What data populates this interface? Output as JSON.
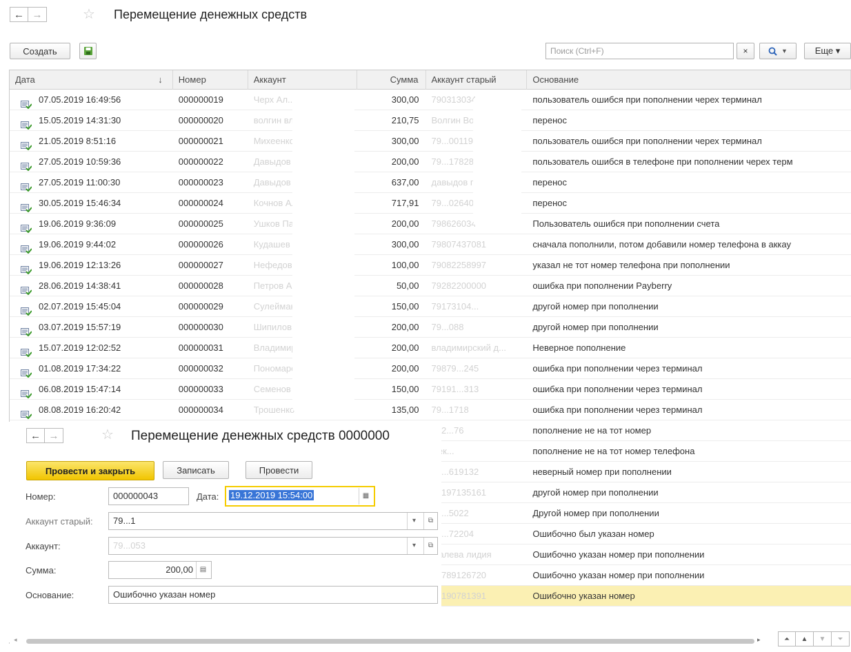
{
  "window": {
    "title": "Перемещение денежных средств",
    "back_arrow": "←",
    "forward_arrow": "→",
    "favorite_star": "☆"
  },
  "toolbar": {
    "create_label": "Создать",
    "search_placeholder": "Поиск (Ctrl+F)",
    "search_clear": "×",
    "search_button": "🔍 ▾",
    "more_label": "Еще ▾"
  },
  "table": {
    "columns": {
      "date": "Дата",
      "number": "Номер",
      "account": "Аккаунт",
      "sum": "Сумма",
      "old_account": "Аккаунт старый",
      "reason": "Основание"
    },
    "sort_indicator": "↓",
    "rows": [
      {
        "date": "07.05.2019 16:49:56",
        "number": "000000019",
        "account": "Черх Ал...",
        "sum": "300,00",
        "old_account": "79031303447",
        "reason": "пользователь ошибся при пополнении черех терминал"
      },
      {
        "date": "15.05.2019 14:31:30",
        "number": "000000020",
        "account": "волгин владим...",
        "sum": "210,75",
        "old_account": "Волгин Волода",
        "reason": "перенос"
      },
      {
        "date": "21.05.2019 8:51:16",
        "number": "000000021",
        "account": "Михеенко В...",
        "sum": "300,00",
        "old_account": "79...001199",
        "reason": "пользователь ошибся при пополнении черех терминал"
      },
      {
        "date": "27.05.2019 10:59:36",
        "number": "000000022",
        "account": "Давыдов ...",
        "sum": "200,00",
        "old_account": "79...178289",
        "reason": "пользователь ошибся в телефоне при пополнении черех терм"
      },
      {
        "date": "27.05.2019 11:00:30",
        "number": "000000023",
        "account": "Давыдов Гр...",
        "sum": "637,00",
        "old_account": "давыдов григорий",
        "reason": "перенос"
      },
      {
        "date": "30.05.2019 15:46:34",
        "number": "000000024",
        "account": "Кочнов Алекса...",
        "sum": "717,91",
        "old_account": "79...02640",
        "reason": "перенос"
      },
      {
        "date": "19.06.2019 9:36:09",
        "number": "000000025",
        "account": "Ушков Павел",
        "sum": "200,00",
        "old_account": "79862603478",
        "reason": "Пользователь ошибся при пополнении счета"
      },
      {
        "date": "19.06.2019 9:44:02",
        "number": "000000026",
        "account": "Кудашев Андр...",
        "sum": "300,00",
        "old_account": "79807437081",
        "reason": "сначала пополнили, потом добавили номер телефона в аккау"
      },
      {
        "date": "19.06.2019 12:13:26",
        "number": "000000027",
        "account": "Нефедов Оле...",
        "sum": "100,00",
        "old_account": "79082258997",
        "reason": "указал не тот номер телефона при пополнении"
      },
      {
        "date": "28.06.2019 14:38:41",
        "number": "000000028",
        "account": "Петров Ан...",
        "sum": "50,00",
        "old_account": "79282200000",
        "reason": "ошибка при пополнении Payberry"
      },
      {
        "date": "02.07.2019 15:45:04",
        "number": "000000029",
        "account": "Сулейманов Р...",
        "sum": "150,00",
        "old_account": "79173104...",
        "reason": "другой номер при пополнении"
      },
      {
        "date": "03.07.2019 15:57:19",
        "number": "000000030",
        "account": "Шипилов Серг...",
        "sum": "200,00",
        "old_account": "79...088",
        "reason": "другой номер при пополнении"
      },
      {
        "date": "15.07.2019 12:02:52",
        "number": "000000031",
        "account": "Владимирский ...",
        "sum": "200,00",
        "old_account": "владимирский д...",
        "reason": "Неверное пополнение"
      },
      {
        "date": "01.08.2019 17:34:22",
        "number": "000000032",
        "account": "Пономарев В...",
        "sum": "200,00",
        "old_account": "79879...245",
        "reason": "ошибка при пополнении через терминал"
      },
      {
        "date": "06.08.2019 15:47:14",
        "number": "000000033",
        "account": "Семенов Вадим",
        "sum": "150,00",
        "old_account": "79191...313",
        "reason": "ошибка при пополнении через терминал"
      },
      {
        "date": "08.08.2019 16:20:42",
        "number": "000000034",
        "account": "Трошенков Ол...",
        "sum": "135,00",
        "old_account": "79...1718",
        "reason": "ошибка при пополнении через терминал"
      },
      {
        "date": "",
        "number": "",
        "account": "",
        "sum": "",
        "old_account": "792...76",
        "reason": "пополнение не на тот номер"
      },
      {
        "date": "",
        "number": "",
        "account": "",
        "sum": "",
        "old_account": "Нек...",
        "reason": "пополнение не на тот номер телефона"
      },
      {
        "date": "",
        "number": "",
        "account": "",
        "sum": "",
        "old_account": "79...619132",
        "reason": "неверный номер при пополнении"
      },
      {
        "date": "",
        "number": "",
        "account": "",
        "sum": "",
        "old_account": "79197135161",
        "reason": "другой номер при пополнении"
      },
      {
        "date": "",
        "number": "",
        "account": "",
        "sum": "",
        "old_account": "79...5022",
        "reason": "Другой номер при пополнении"
      },
      {
        "date": "",
        "number": "",
        "account": "",
        "sum": "",
        "old_account": "79...72204",
        "reason": "Ошибочно был указан номер"
      },
      {
        "date": "",
        "number": "",
        "account": "",
        "sum": "",
        "old_account": "...алева лидия",
        "reason": "Ошибочно указан номер при пополнении"
      },
      {
        "date": "",
        "number": "",
        "account": "",
        "sum": "",
        "old_account": "79789126720",
        "reason": "Ошибочно указан номер при пополнении"
      },
      {
        "date": "",
        "number": "",
        "account": "",
        "sum": "",
        "old_account": "79190781391",
        "reason": "Ошибочно указан номер"
      }
    ]
  },
  "form": {
    "title": "Перемещение денежных средств 0000000",
    "post_close_label": "Провести и закрыть",
    "save_label": "Записать",
    "post_label": "Провести",
    "number_label": "Номер:",
    "number_value": "000000043",
    "date_label": "Дата:",
    "date_value": "19.12.2019 15:54:00",
    "old_account_label": "Аккаунт старый:",
    "old_account_value": "79...1",
    "account_label": "Аккаунт:",
    "account_value": "79...053",
    "sum_label": "Сумма:",
    "sum_value": "200,00",
    "reason_label": "Основание:",
    "reason_value": "Ошибочно указан номер"
  },
  "colors": {
    "accent_yellow": "#f5cc00",
    "selected_row": "#fbf0b3",
    "date_highlight": "#3875d7"
  }
}
